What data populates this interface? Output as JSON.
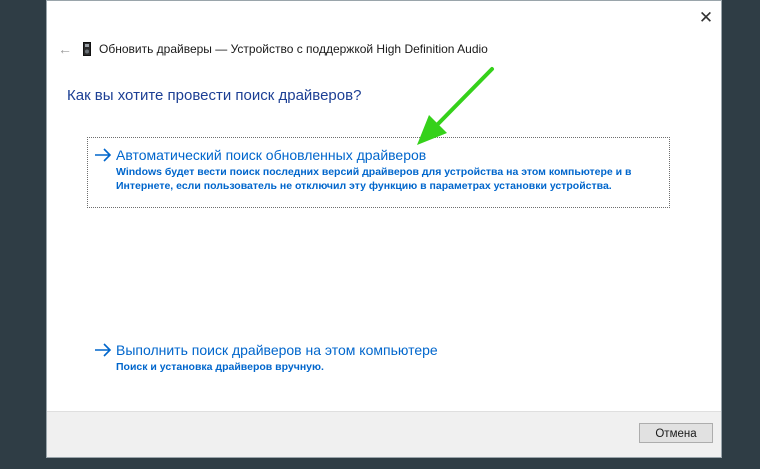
{
  "window": {
    "close_glyph": "✕"
  },
  "header": {
    "back_glyph": "←",
    "title": "Обновить драйверы — Устройство с поддержкой High Definition Audio",
    "device_icon": "audio-device-icon"
  },
  "heading": "Как вы хотите провести поиск драйверов?",
  "options": [
    {
      "title": "Автоматический поиск обновленных драйверов",
      "description_line1": "Windows будет вести поиск последних версий драйверов для устройства на этом компьютере и в",
      "description_line2": "Интернете, если пользователь не отключил эту функцию в параметрах установки устройства."
    },
    {
      "title": "Выполнить поиск драйверов на этом компьютере",
      "description_line1": "Поиск и установка драйверов вручную."
    }
  ],
  "footer": {
    "cancel_label": "Отмена"
  },
  "colors": {
    "link_blue": "#0066cc",
    "heading_blue": "#1c3f94",
    "annotation_green": "#35d11a"
  }
}
